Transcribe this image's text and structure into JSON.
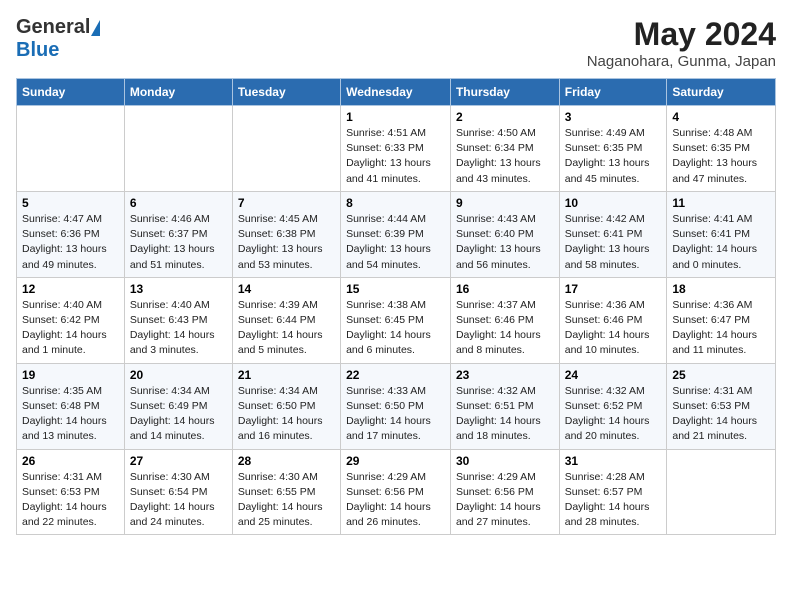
{
  "header": {
    "logo_general": "General",
    "logo_blue": "Blue",
    "month_title": "May 2024",
    "location": "Naganohara, Gunma, Japan"
  },
  "weekdays": [
    "Sunday",
    "Monday",
    "Tuesday",
    "Wednesday",
    "Thursday",
    "Friday",
    "Saturday"
  ],
  "weeks": [
    [
      {
        "day": "",
        "sunrise": "",
        "sunset": "",
        "daylight": ""
      },
      {
        "day": "",
        "sunrise": "",
        "sunset": "",
        "daylight": ""
      },
      {
        "day": "",
        "sunrise": "",
        "sunset": "",
        "daylight": ""
      },
      {
        "day": "1",
        "sunrise": "Sunrise: 4:51 AM",
        "sunset": "Sunset: 6:33 PM",
        "daylight": "Daylight: 13 hours and 41 minutes."
      },
      {
        "day": "2",
        "sunrise": "Sunrise: 4:50 AM",
        "sunset": "Sunset: 6:34 PM",
        "daylight": "Daylight: 13 hours and 43 minutes."
      },
      {
        "day": "3",
        "sunrise": "Sunrise: 4:49 AM",
        "sunset": "Sunset: 6:35 PM",
        "daylight": "Daylight: 13 hours and 45 minutes."
      },
      {
        "day": "4",
        "sunrise": "Sunrise: 4:48 AM",
        "sunset": "Sunset: 6:35 PM",
        "daylight": "Daylight: 13 hours and 47 minutes."
      }
    ],
    [
      {
        "day": "5",
        "sunrise": "Sunrise: 4:47 AM",
        "sunset": "Sunset: 6:36 PM",
        "daylight": "Daylight: 13 hours and 49 minutes."
      },
      {
        "day": "6",
        "sunrise": "Sunrise: 4:46 AM",
        "sunset": "Sunset: 6:37 PM",
        "daylight": "Daylight: 13 hours and 51 minutes."
      },
      {
        "day": "7",
        "sunrise": "Sunrise: 4:45 AM",
        "sunset": "Sunset: 6:38 PM",
        "daylight": "Daylight: 13 hours and 53 minutes."
      },
      {
        "day": "8",
        "sunrise": "Sunrise: 4:44 AM",
        "sunset": "Sunset: 6:39 PM",
        "daylight": "Daylight: 13 hours and 54 minutes."
      },
      {
        "day": "9",
        "sunrise": "Sunrise: 4:43 AM",
        "sunset": "Sunset: 6:40 PM",
        "daylight": "Daylight: 13 hours and 56 minutes."
      },
      {
        "day": "10",
        "sunrise": "Sunrise: 4:42 AM",
        "sunset": "Sunset: 6:41 PM",
        "daylight": "Daylight: 13 hours and 58 minutes."
      },
      {
        "day": "11",
        "sunrise": "Sunrise: 4:41 AM",
        "sunset": "Sunset: 6:41 PM",
        "daylight": "Daylight: 14 hours and 0 minutes."
      }
    ],
    [
      {
        "day": "12",
        "sunrise": "Sunrise: 4:40 AM",
        "sunset": "Sunset: 6:42 PM",
        "daylight": "Daylight: 14 hours and 1 minute."
      },
      {
        "day": "13",
        "sunrise": "Sunrise: 4:40 AM",
        "sunset": "Sunset: 6:43 PM",
        "daylight": "Daylight: 14 hours and 3 minutes."
      },
      {
        "day": "14",
        "sunrise": "Sunrise: 4:39 AM",
        "sunset": "Sunset: 6:44 PM",
        "daylight": "Daylight: 14 hours and 5 minutes."
      },
      {
        "day": "15",
        "sunrise": "Sunrise: 4:38 AM",
        "sunset": "Sunset: 6:45 PM",
        "daylight": "Daylight: 14 hours and 6 minutes."
      },
      {
        "day": "16",
        "sunrise": "Sunrise: 4:37 AM",
        "sunset": "Sunset: 6:46 PM",
        "daylight": "Daylight: 14 hours and 8 minutes."
      },
      {
        "day": "17",
        "sunrise": "Sunrise: 4:36 AM",
        "sunset": "Sunset: 6:46 PM",
        "daylight": "Daylight: 14 hours and 10 minutes."
      },
      {
        "day": "18",
        "sunrise": "Sunrise: 4:36 AM",
        "sunset": "Sunset: 6:47 PM",
        "daylight": "Daylight: 14 hours and 11 minutes."
      }
    ],
    [
      {
        "day": "19",
        "sunrise": "Sunrise: 4:35 AM",
        "sunset": "Sunset: 6:48 PM",
        "daylight": "Daylight: 14 hours and 13 minutes."
      },
      {
        "day": "20",
        "sunrise": "Sunrise: 4:34 AM",
        "sunset": "Sunset: 6:49 PM",
        "daylight": "Daylight: 14 hours and 14 minutes."
      },
      {
        "day": "21",
        "sunrise": "Sunrise: 4:34 AM",
        "sunset": "Sunset: 6:50 PM",
        "daylight": "Daylight: 14 hours and 16 minutes."
      },
      {
        "day": "22",
        "sunrise": "Sunrise: 4:33 AM",
        "sunset": "Sunset: 6:50 PM",
        "daylight": "Daylight: 14 hours and 17 minutes."
      },
      {
        "day": "23",
        "sunrise": "Sunrise: 4:32 AM",
        "sunset": "Sunset: 6:51 PM",
        "daylight": "Daylight: 14 hours and 18 minutes."
      },
      {
        "day": "24",
        "sunrise": "Sunrise: 4:32 AM",
        "sunset": "Sunset: 6:52 PM",
        "daylight": "Daylight: 14 hours and 20 minutes."
      },
      {
        "day": "25",
        "sunrise": "Sunrise: 4:31 AM",
        "sunset": "Sunset: 6:53 PM",
        "daylight": "Daylight: 14 hours and 21 minutes."
      }
    ],
    [
      {
        "day": "26",
        "sunrise": "Sunrise: 4:31 AM",
        "sunset": "Sunset: 6:53 PM",
        "daylight": "Daylight: 14 hours and 22 minutes."
      },
      {
        "day": "27",
        "sunrise": "Sunrise: 4:30 AM",
        "sunset": "Sunset: 6:54 PM",
        "daylight": "Daylight: 14 hours and 24 minutes."
      },
      {
        "day": "28",
        "sunrise": "Sunrise: 4:30 AM",
        "sunset": "Sunset: 6:55 PM",
        "daylight": "Daylight: 14 hours and 25 minutes."
      },
      {
        "day": "29",
        "sunrise": "Sunrise: 4:29 AM",
        "sunset": "Sunset: 6:56 PM",
        "daylight": "Daylight: 14 hours and 26 minutes."
      },
      {
        "day": "30",
        "sunrise": "Sunrise: 4:29 AM",
        "sunset": "Sunset: 6:56 PM",
        "daylight": "Daylight: 14 hours and 27 minutes."
      },
      {
        "day": "31",
        "sunrise": "Sunrise: 4:28 AM",
        "sunset": "Sunset: 6:57 PM",
        "daylight": "Daylight: 14 hours and 28 minutes."
      },
      {
        "day": "",
        "sunrise": "",
        "sunset": "",
        "daylight": ""
      }
    ]
  ]
}
